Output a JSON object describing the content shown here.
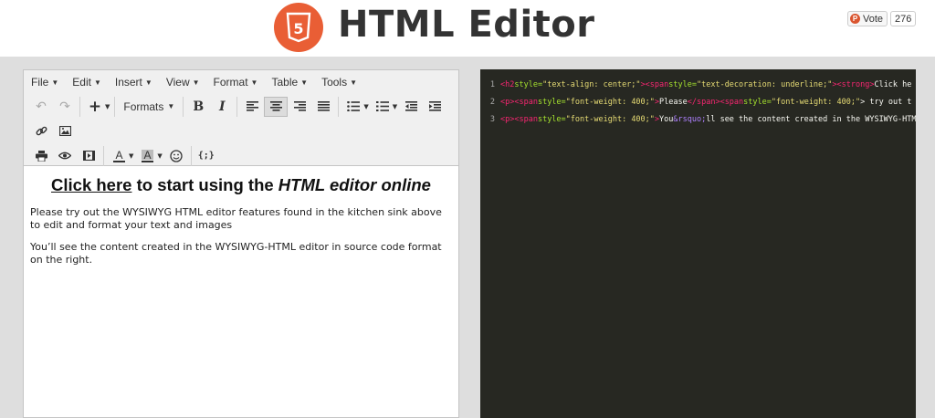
{
  "header": {
    "title": "HTML Editor",
    "vote_label": "Vote",
    "vote_count": "276",
    "logo_number": "5"
  },
  "menubar": [
    "File",
    "Edit",
    "Insert",
    "View",
    "Format",
    "Table",
    "Tools"
  ],
  "toolbar": {
    "formats_label": "Formats",
    "code_label": "{;}"
  },
  "content": {
    "heading_link": "Click here",
    "heading_mid": " to start using the ",
    "heading_em": "HTML editor online",
    "para1": "Please try out the WYSIWYG HTML editor features found in the kitchen sink above to edit and format your text and images",
    "para2": "You’ll see the content created in the WYSIWYG-HTML editor in source code format on the right."
  },
  "code": {
    "line_numbers": [
      "1",
      "2",
      "3"
    ],
    "l1_p1": "<h2 ",
    "l1_p2": "style=",
    "l1_p3": "\"text-align: center;\"",
    "l1_p4": "><span ",
    "l1_p5": "style=",
    "l1_p6": "\"text-decoration: underline;\"",
    "l1_p7": "><strong>",
    "l1_p8": "Click he",
    "l2_p1": "<p><span ",
    "l2_p2": "style=",
    "l2_p3": "\"font-weight: 400;\"",
    "l2_p4": ">",
    "l2_p5": "Please",
    "l2_p6": "</span><span ",
    "l2_p7": "style=",
    "l2_p8": "\"font-weight: 400;\"",
    "l2_p9": "> try out t",
    "l3_p1": "<p><span ",
    "l3_p2": "style=",
    "l3_p3": "\"font-weight: 400;\"",
    "l3_p4": ">",
    "l3_p5": "You",
    "l3_p6": "&rsquo;",
    "l3_p7": "ll see the content created in the WYSIWYG-HTM"
  },
  "colors": {
    "logo": "#e95e35",
    "code_bg": "#272822",
    "stage_bg": "#dedede"
  }
}
